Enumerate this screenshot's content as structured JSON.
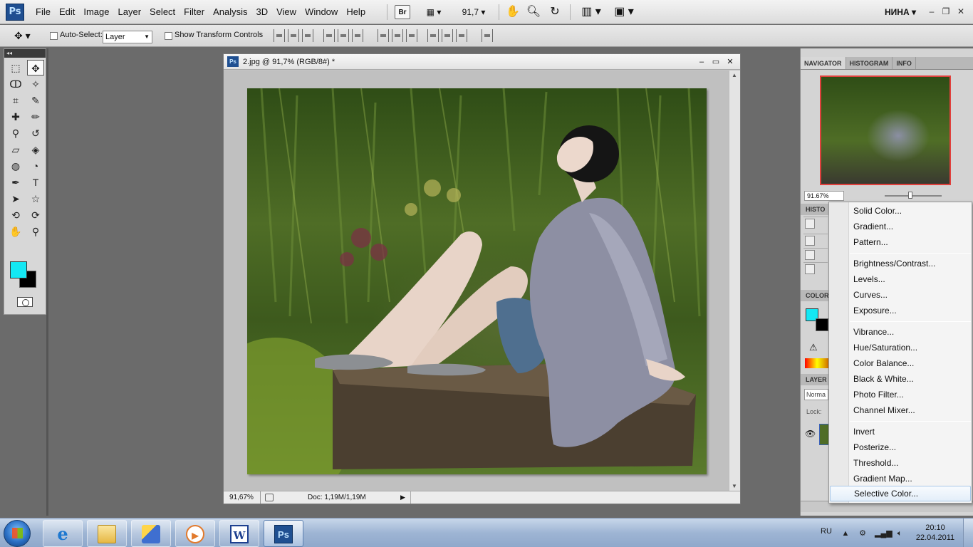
{
  "app": {
    "logo": "Ps",
    "menu": [
      "File",
      "Edit",
      "Image",
      "Layer",
      "Select",
      "Filter",
      "Analysis",
      "3D",
      "View",
      "Window",
      "Help"
    ],
    "bridge_label": "Br",
    "zoom_value": "91,7",
    "workspace_user": "НИНА",
    "window_controls": [
      "minimize",
      "restore",
      "close"
    ]
  },
  "options_bar": {
    "auto_select_label": "Auto-Select:",
    "auto_select_target": "Layer",
    "show_transform_label": "Show Transform Controls"
  },
  "tools": {
    "foreground_color": "#14e8f4",
    "background_color": "#000000"
  },
  "document": {
    "title": "2.jpg @ 91,7% (RGB/8#) *",
    "zoom": "91,67%",
    "doc_size": "Doc: 1,19M/1,19M"
  },
  "right_panels": {
    "top_tabs": [
      "NAVIGATOR",
      "HISTOGRAM",
      "INFO"
    ],
    "navigator_zoom": "91.67%",
    "history_label": "HISTO",
    "color_label": "COLOR",
    "layers_label": "LAYER",
    "blend_mode": "Norma",
    "lock_label": "Lock:"
  },
  "adjustment_menu": {
    "groups": [
      [
        "Solid Color...",
        "Gradient...",
        "Pattern..."
      ],
      [
        "Brightness/Contrast...",
        "Levels...",
        "Curves...",
        "Exposure..."
      ],
      [
        "Vibrance...",
        "Hue/Saturation...",
        "Color Balance...",
        "Black & White...",
        "Photo Filter...",
        "Channel Mixer..."
      ],
      [
        "Invert",
        "Posterize...",
        "Threshold...",
        "Gradient Map...",
        "Selective Color..."
      ]
    ],
    "highlighted": "Selective Color..."
  },
  "taskbar": {
    "apps": [
      "Internet Explorer",
      "Windows Explorer",
      "Mail",
      "Media Player",
      "Word",
      "Photoshop"
    ],
    "word_label": "W",
    "ps_label": "Ps",
    "language": "RU",
    "time": "20:10",
    "date": "22.04.2011"
  }
}
